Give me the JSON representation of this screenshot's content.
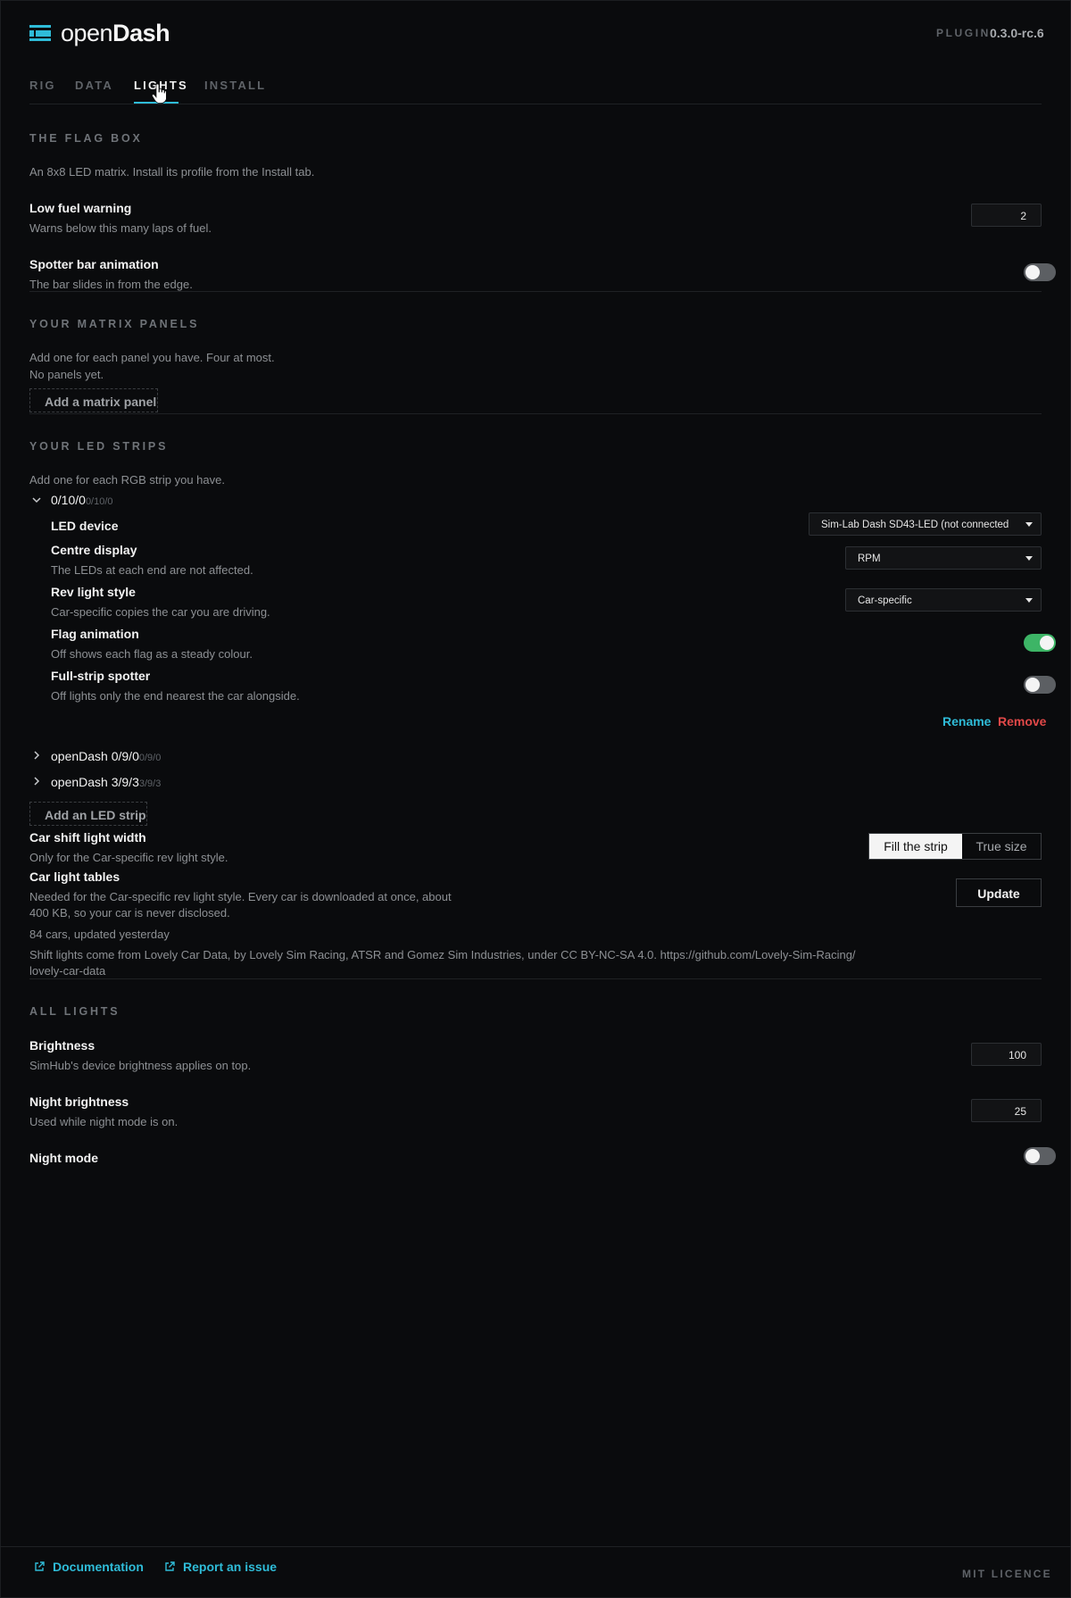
{
  "app": {
    "brand_light": "open",
    "brand_bold": "Dash",
    "plugin_label": "PLUGIN",
    "version": "0.3.0-rc.6"
  },
  "tabs": [
    {
      "label": "RIG",
      "active": false
    },
    {
      "label": "DATA",
      "active": false
    },
    {
      "label": "LIGHTS",
      "active": true
    },
    {
      "label": "INSTALL",
      "active": false
    }
  ],
  "flag_box": {
    "title": "THE FLAG BOX",
    "intro": "An 8x8 LED matrix. Install its profile from the Install tab.",
    "low_fuel": {
      "label": "Low fuel warning",
      "desc": "Warns below this many laps of fuel.",
      "value": "2"
    },
    "spotter": {
      "label": "Spotter bar animation",
      "desc": "The bar slides in from the edge.",
      "on": false
    }
  },
  "matrix": {
    "title": "YOUR MATRIX PANELS",
    "intro": "Add one for each panel you have. Four at most.",
    "empty": "No panels yet.",
    "add_label": "Add a matrix panel"
  },
  "strips": {
    "title": "YOUR LED STRIPS",
    "intro": "Add one for each RGB strip you have.",
    "expanded": {
      "name": "0/10/0",
      "sub": "0/10/0",
      "device": {
        "label": "LED device",
        "value": "Sim-Lab Dash SD43-LED (not connected"
      },
      "centre": {
        "label": "Centre display",
        "desc": "The LEDs at each end are not affected.",
        "value": "RPM"
      },
      "rev": {
        "label": "Rev light style",
        "desc": "Car-specific copies the car you are driving.",
        "value": "Car-specific"
      },
      "flag_anim": {
        "label": "Flag animation",
        "desc": "Off shows each flag as a steady colour.",
        "on": true
      },
      "full_spotter": {
        "label": "Full-strip spotter",
        "desc": "Off lights only the end nearest the car alongside.",
        "on": false
      },
      "rename": "Rename",
      "remove": "Remove"
    },
    "collapsed": [
      {
        "name": "openDash 0/9/0",
        "sub": "0/9/0"
      },
      {
        "name": "openDash 3/9/3",
        "sub": "3/9/3"
      }
    ],
    "add_label": "Add an LED strip",
    "shift_width": {
      "label": "Car shift light width",
      "desc": "Only for the Car-specific rev light style.",
      "options": [
        "Fill the strip",
        "True size"
      ],
      "selected": "Fill the strip"
    },
    "tables": {
      "label": "Car light tables",
      "desc_line1": "Needed for the Car-specific rev light style. Every car is downloaded at once, about",
      "desc_line2": "400 KB, so your car is never disclosed.",
      "status": "84 cars, updated yesterday",
      "credit_line1": "Shift lights come from Lovely Car Data, by Lovely Sim Racing, ATSR and Gomez Sim Industries, under CC BY-NC-SA 4.0. https://github.com/Lovely-Sim-Racing/",
      "credit_line2": "lovely-car-data",
      "update_label": "Update"
    }
  },
  "all_lights": {
    "title": "ALL LIGHTS",
    "brightness": {
      "label": "Brightness",
      "desc": "SimHub's device brightness applies on top.",
      "value": "100"
    },
    "night_brightness": {
      "label": "Night brightness",
      "desc": "Used while night mode is on.",
      "value": "25"
    },
    "night_mode": {
      "label": "Night mode",
      "on": false
    }
  },
  "footer": {
    "docs": "Documentation",
    "issue": "Report an issue",
    "licence": "MIT LICENCE"
  },
  "colors": {
    "accent": "#2fbcd8",
    "danger": "#e04848",
    "toggle_on": "#3db566",
    "background": "#0a0b0d"
  }
}
